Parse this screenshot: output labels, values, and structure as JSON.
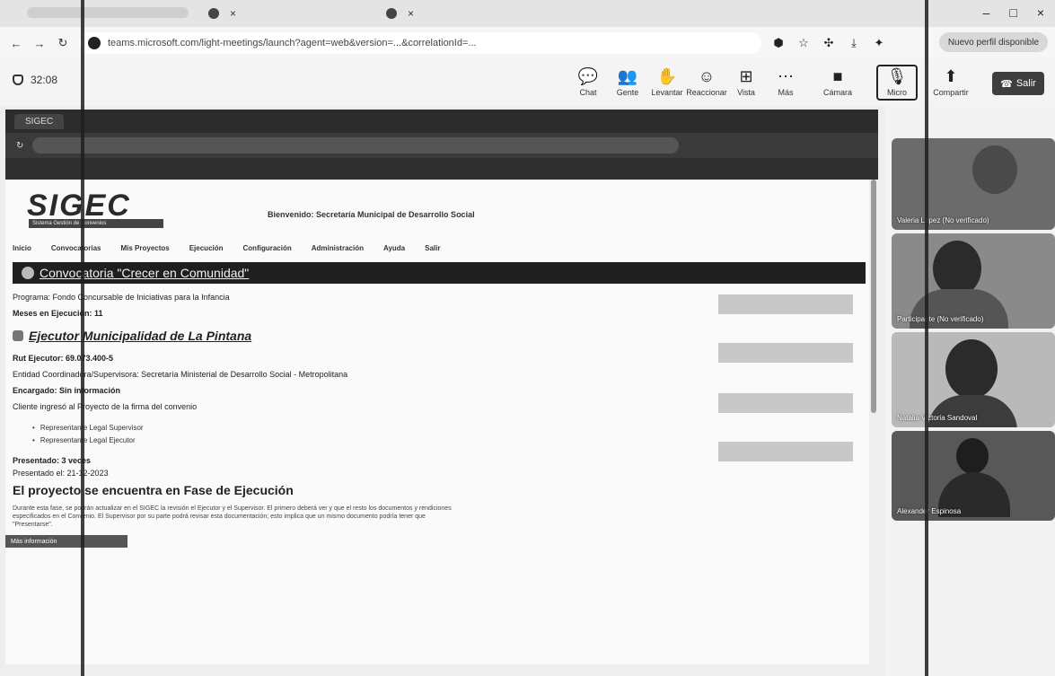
{
  "browser": {
    "tab_close": "×",
    "window_controls": [
      "–",
      "□",
      "×"
    ],
    "url": "teams.microsoft.com/light-meetings/launch?agent=web&version=...&correlationId=...",
    "nav_icons": [
      "arrow-left-icon",
      "arrow-right-icon",
      "reload-icon"
    ],
    "profile": "Nuevo perfil disponible"
  },
  "meeting": {
    "timer": "32:08",
    "tools": [
      {
        "label": "Chat",
        "glyph": "💬",
        "icon": "chat-icon"
      },
      {
        "label": "Gente",
        "glyph": "👥",
        "icon": "people-icon"
      },
      {
        "label": "Levantar",
        "glyph": "✋",
        "icon": "raise-hand-icon"
      },
      {
        "label": "Reaccionar",
        "glyph": "☺",
        "icon": "react-icon"
      },
      {
        "label": "Vista",
        "glyph": "⊞",
        "icon": "view-icon"
      },
      {
        "label": "Más",
        "glyph": "⋯",
        "icon": "more-icon"
      },
      {
        "label": "Cámara",
        "glyph": "■",
        "icon": "camera-icon"
      },
      {
        "label": "Micro",
        "glyph": "🎙",
        "icon": "microphone-icon"
      },
      {
        "label": "Compartir",
        "glyph": "⬆",
        "icon": "share-icon"
      }
    ],
    "leave_label": "Salir"
  },
  "shared_screen": {
    "welcome": "Bienvenido: Secretaría Municipal de Desarrollo Social",
    "logo_word": "SIGEC",
    "logo_sub": "Sistema Gestión de Convenios",
    "menu": [
      "Inicio",
      "Convocatorias",
      "Mis Proyectos",
      "Ejecución",
      "Configuración",
      "Administración",
      "Ayuda",
      "Salir"
    ],
    "convocatoria_title": "Convocatoria \"Crecer en Comunidad\"",
    "programa": "Programa: Fondo Concursable de Iniciativas para la Infancia",
    "meses": "Meses en Ejecución: 11",
    "ejecutor": "Ejecutor Municipalidad de La Pintana",
    "rut": "Rut Ejecutor: 69.073.400-5",
    "entidad": "Entidad Coordinadora/Supervisora: Secretaría Ministerial de Desarrollo Social - Metropolitana",
    "encargado": "Encargado: Sin información",
    "cliente": "Cliente ingresó al Proyecto de la firma del convenio",
    "bullets": [
      "Representante Legal Supervisor",
      "Representante Legal Ejecutor"
    ],
    "presentado": "Presentado: 3 veces",
    "presentado_fecha": "Presentado el: 21-12-2023",
    "fase_title": "El proyecto se encuentra en Fase de Ejecución",
    "fase_desc": "Durante esta fase, se podrán actualizar en el SIGEC la revisión el Ejecutor y el Supervisor. El primero deberá ver y que el resto los documentos y rendiciones especificados en el Convenio. El Supervisor por su parte podrá revisar esta documentación; esto implica que un mismo documento podría tener que \"Presentarse\".",
    "mas_info": "Más información"
  },
  "participants": [
    {
      "name": "Valeria López (No verificado)"
    },
    {
      "name": "Participante (No verificado)"
    },
    {
      "name": "Natalia Victoria Sandoval"
    },
    {
      "name": "Alexander Espinosa"
    }
  ]
}
